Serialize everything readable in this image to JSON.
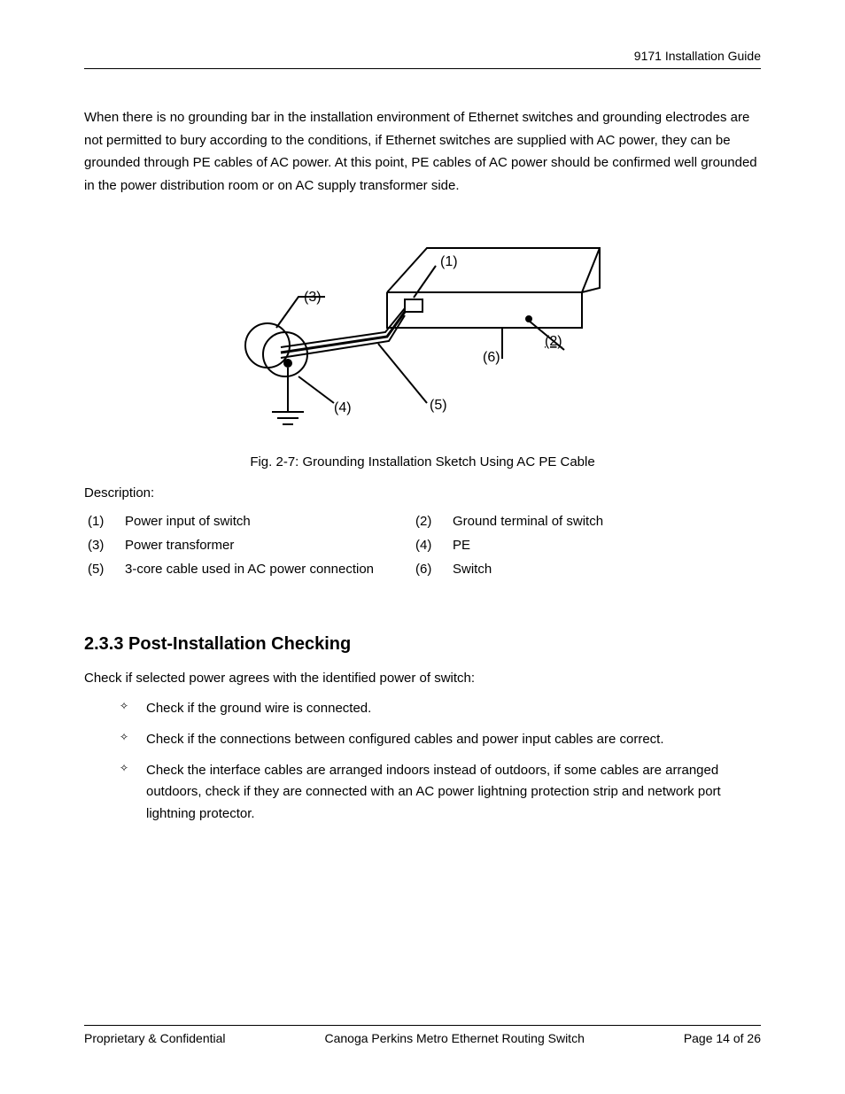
{
  "header": {
    "title": "9171 Installation Guide"
  },
  "intro": "When there is no grounding bar in the installation environment of Ethernet switches and grounding electrodes are not permitted to bury according to the conditions, if Ethernet switches are supplied with AC power, they can be grounded through PE cables of AC power. At this point, PE cables of AC power should be confirmed well grounded in the power distribution room or on AC supply transformer side.",
  "figure": {
    "caption": "Fig. 2-7: Grounding Installation Sketch Using AC PE Cable",
    "callouts": {
      "c1": "(1)",
      "c2": "(2)",
      "c3": "(3)",
      "c4": "(4)",
      "c5": "(5)",
      "c6": "(6)"
    }
  },
  "description": {
    "label": "Description:",
    "items": [
      {
        "n": "(1)",
        "t": "Power input of switch"
      },
      {
        "n": "(2)",
        "t": "Ground terminal of switch"
      },
      {
        "n": "(3)",
        "t": "Power transformer"
      },
      {
        "n": "(4)",
        "t": "PE"
      },
      {
        "n": "(5)",
        "t": "3-core cable used in AC power connection"
      },
      {
        "n": "(6)",
        "t": "Switch"
      }
    ]
  },
  "section": {
    "heading": "2.3.3 Post-Installation Checking",
    "intro": "Check if selected power agrees with the identified power of switch:",
    "bullets": [
      "Check if the ground wire is connected.",
      "Check if the connections between configured cables and power input cables are correct.",
      "Check the interface cables are arranged indoors instead of outdoors, if some cables are arranged outdoors, check if they are connected with an AC power lightning protection strip and network port lightning protector."
    ]
  },
  "footer": {
    "left": "Proprietary & Confidential",
    "center": "Canoga Perkins Metro Ethernet Routing Switch",
    "right": "Page 14 of 26"
  }
}
